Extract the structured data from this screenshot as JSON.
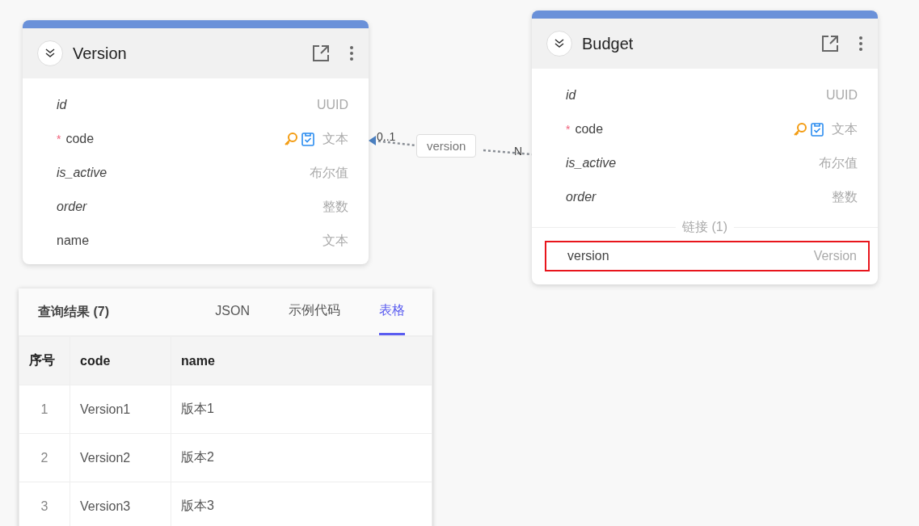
{
  "entities": [
    {
      "title": "Version",
      "fields": [
        {
          "name": "id",
          "kind": "system",
          "constraints": false,
          "type": "UUID"
        },
        {
          "name": "code",
          "kind": "custom",
          "required_mark": "*",
          "constraints": true,
          "type": "文本"
        },
        {
          "name": "is_active",
          "kind": "system",
          "constraints": false,
          "type": "布尔值"
        },
        {
          "name": "order",
          "kind": "system",
          "constraints": false,
          "type": "整数"
        },
        {
          "name": "name",
          "kind": "custom",
          "constraints": false,
          "type": "文本"
        }
      ]
    },
    {
      "title": "Budget",
      "fields": [
        {
          "name": "id",
          "kind": "system",
          "constraints": false,
          "type": "UUID"
        },
        {
          "name": "code",
          "kind": "custom",
          "required_mark": "*",
          "constraints": true,
          "type": "文本"
        },
        {
          "name": "is_active",
          "kind": "system",
          "constraints": false,
          "type": "布尔值"
        },
        {
          "name": "order",
          "kind": "system",
          "constraints": false,
          "type": "整数"
        }
      ],
      "links_heading": "链接 (1)",
      "links": [
        {
          "name": "version",
          "type": "Version",
          "selected": true
        }
      ]
    }
  ],
  "relation": {
    "label": "version",
    "from_cardinality": "0..1",
    "to_cardinality": "N"
  },
  "results": {
    "title": "查询结果 (7)",
    "tabs": [
      {
        "label": "JSON",
        "selected": false
      },
      {
        "label": "示例代码",
        "selected": false
      },
      {
        "label": "表格",
        "selected": true
      }
    ],
    "columns": [
      "序号",
      "code",
      "name"
    ],
    "rows": [
      [
        "1",
        "Version1",
        "版本1"
      ],
      [
        "2",
        "Version2",
        "版本2"
      ],
      [
        "3",
        "Version3",
        "版本3"
      ]
    ]
  }
}
